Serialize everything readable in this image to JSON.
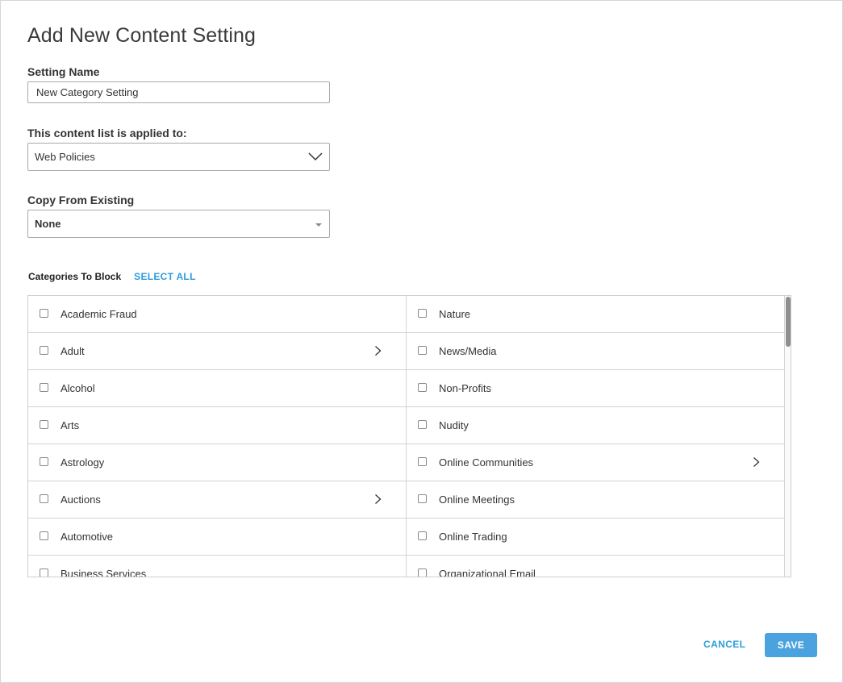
{
  "dialog": {
    "title": "Add New Content Setting"
  },
  "setting_name": {
    "label": "Setting Name",
    "value": "New Category Setting"
  },
  "applied_to": {
    "label": "This content list is applied to:",
    "selected": "Web Policies",
    "icon": "chevron-down-icon"
  },
  "copy_from": {
    "label": "Copy From Existing",
    "selected": "None",
    "icon": "caret-down-icon"
  },
  "categories": {
    "label": "Categories To Block",
    "select_all": "SELECT ALL",
    "left": [
      {
        "name": "Academic Fraud",
        "has_sub": false
      },
      {
        "name": "Adult",
        "has_sub": true
      },
      {
        "name": "Alcohol",
        "has_sub": false
      },
      {
        "name": "Arts",
        "has_sub": false
      },
      {
        "name": "Astrology",
        "has_sub": false
      },
      {
        "name": "Auctions",
        "has_sub": true
      },
      {
        "name": "Automotive",
        "has_sub": false
      },
      {
        "name": "Business Services",
        "has_sub": false
      }
    ],
    "right": [
      {
        "name": "Nature",
        "has_sub": false
      },
      {
        "name": "News/Media",
        "has_sub": false
      },
      {
        "name": "Non-Profits",
        "has_sub": false
      },
      {
        "name": "Nudity",
        "has_sub": false
      },
      {
        "name": "Online Communities",
        "has_sub": true
      },
      {
        "name": "Online Meetings",
        "has_sub": false
      },
      {
        "name": "Online Trading",
        "has_sub": false
      },
      {
        "name": "Organizational Email",
        "has_sub": false
      }
    ]
  },
  "actions": {
    "cancel": "CANCEL",
    "save": "SAVE"
  },
  "colors": {
    "accent": "#2d9cdb",
    "save_button": "#4aa3df"
  }
}
